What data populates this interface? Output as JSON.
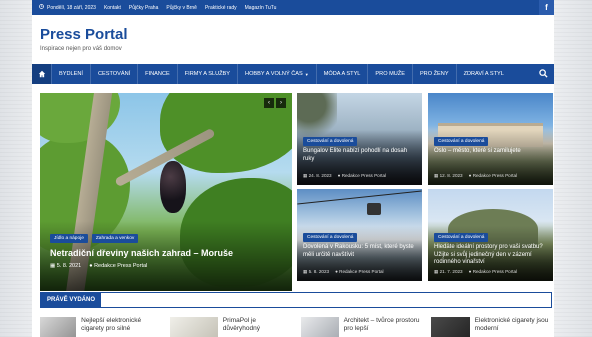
{
  "topbar": {
    "date": "Pondělí, 18 září, 2023",
    "links": [
      "Kontakt",
      "Půjčky Praha",
      "Půjčky v Brně",
      "Praktické rady",
      "Magazín TuTu"
    ]
  },
  "site": {
    "title": "Press Portal",
    "tagline": "Inspirace nejen pro váš domov"
  },
  "nav": {
    "items": [
      {
        "label": "BYDLENÍ",
        "caret": false
      },
      {
        "label": "CESTOVÁNÍ",
        "caret": false
      },
      {
        "label": "FINANCE",
        "caret": false
      },
      {
        "label": "FIRMY A SLUŽBY",
        "caret": false
      },
      {
        "label": "HOBBY A VOLNÝ ČAS",
        "caret": true
      },
      {
        "label": "MÓDA A STYL",
        "caret": false
      },
      {
        "label": "PRO MUŽE",
        "caret": false
      },
      {
        "label": "PRO ŽENY",
        "caret": false
      },
      {
        "label": "ZDRAVÍ A STYL",
        "caret": false
      }
    ]
  },
  "hero": {
    "tags": [
      "Jídlo a nápoje",
      "Zahrada a venkov"
    ],
    "title": "Netradiční dřeviny našich zahrad – Moruše",
    "date": "5. 8. 2021",
    "author": "Redakce Press Portal"
  },
  "cards": [
    {
      "tag": "Cestování a dovolená",
      "title": "Bungalov Elite nabízí pohodlí na dosah ruky",
      "date": "24. 8. 2023",
      "author": "Redakce Press Portal"
    },
    {
      "tag": "Cestování a dovolená",
      "title": "Oslo – město, které si zamilujete",
      "date": "12. 8. 2023",
      "author": "Redakce Press Portal"
    },
    {
      "tag": "Cestování a dovolená",
      "title": "Dovolená v Rakousku: 5 míst, které byste měli určitě navštívit",
      "date": "5. 8. 2023",
      "author": "Redakce Press Portal"
    },
    {
      "tag": "Cestování a dovolená",
      "title": "Hledáte ideální prostory pro vaši svatbu? Užijte si svůj jedinečný den v zázemí rodinného vinařství",
      "date": "21. 7. 2023",
      "author": "Redakce Press Portal"
    }
  ],
  "latest": {
    "title": "PRÁVĚ VYDÁNO",
    "items": [
      {
        "text": "Nejlepší elektronické cigarety pro silné"
      },
      {
        "text": "PrimaPol je důvěryhodný"
      },
      {
        "text": "Architekt – tvůrce prostoru pro lepší"
      },
      {
        "text": "Elektronické cigarety jsou moderní"
      }
    ]
  },
  "colors": {
    "brand": "#1a4c9b"
  }
}
